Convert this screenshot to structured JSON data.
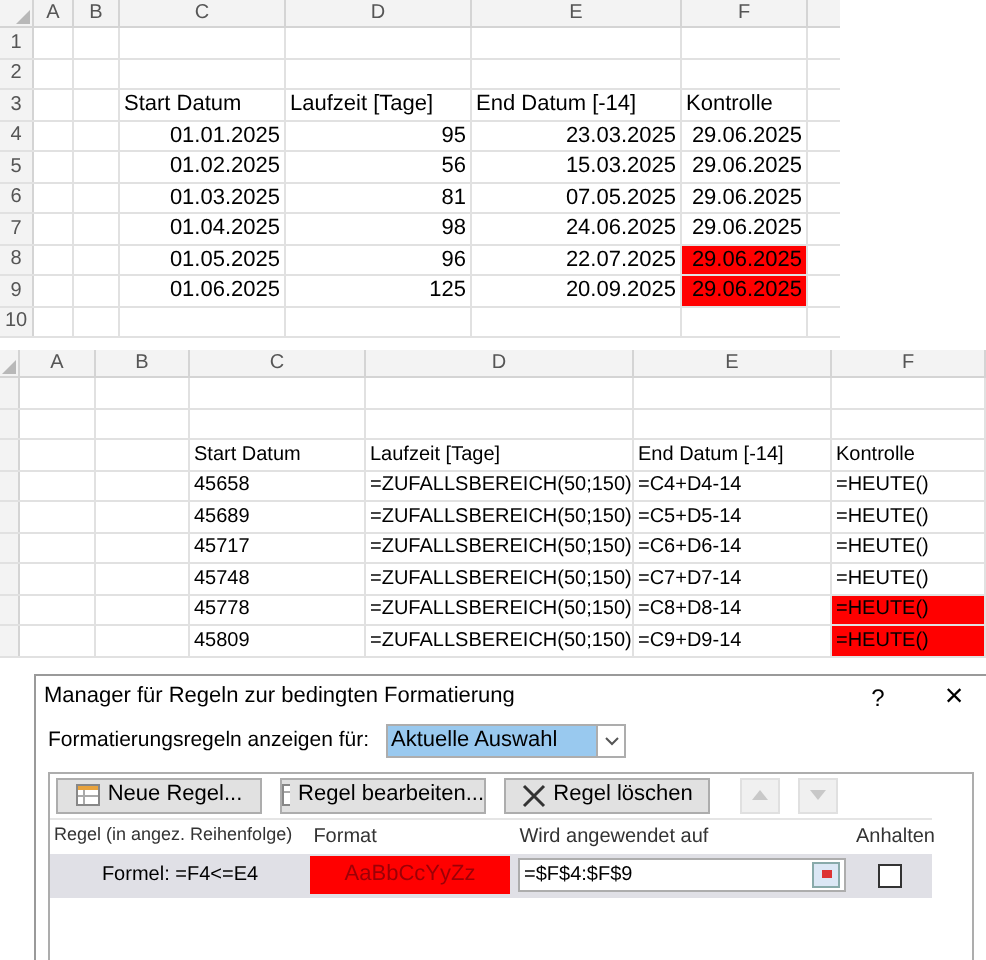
{
  "sheets": [
    {
      "columns": [
        "A",
        "B",
        "C",
        "D",
        "E",
        "F"
      ],
      "rows": [
        {
          "number": "1",
          "kind": "empty",
          "cells": []
        },
        {
          "number": "2",
          "kind": "empty",
          "cells": []
        },
        {
          "number": "3",
          "kind": "header",
          "cells": [
            {
              "text": "",
              "highlighted": false
            },
            {
              "text": "",
              "highlighted": false
            },
            {
              "text": "Start Datum",
              "highlighted": false
            },
            {
              "text": "Laufzeit [Tage]",
              "highlighted": false
            },
            {
              "text": "End Datum [-14]",
              "highlighted": false
            },
            {
              "text": "Kontrolle",
              "highlighted": false
            }
          ]
        },
        {
          "number": "4",
          "kind": "value",
          "cells": [
            {
              "text": "",
              "highlighted": false
            },
            {
              "text": "",
              "highlighted": false
            },
            {
              "text": "01.01.2025",
              "highlighted": false
            },
            {
              "text": "95",
              "highlighted": false
            },
            {
              "text": "23.03.2025",
              "highlighted": false
            },
            {
              "text": "29.06.2025",
              "highlighted": false
            }
          ]
        },
        {
          "number": "5",
          "kind": "value",
          "cells": [
            {
              "text": "",
              "highlighted": false
            },
            {
              "text": "",
              "highlighted": false
            },
            {
              "text": "01.02.2025",
              "highlighted": false
            },
            {
              "text": "56",
              "highlighted": false
            },
            {
              "text": "15.03.2025",
              "highlighted": false
            },
            {
              "text": "29.06.2025",
              "highlighted": false
            }
          ]
        },
        {
          "number": "6",
          "kind": "value",
          "cells": [
            {
              "text": "",
              "highlighted": false
            },
            {
              "text": "",
              "highlighted": false
            },
            {
              "text": "01.03.2025",
              "highlighted": false
            },
            {
              "text": "81",
              "highlighted": false
            },
            {
              "text": "07.05.2025",
              "highlighted": false
            },
            {
              "text": "29.06.2025",
              "highlighted": false
            }
          ]
        },
        {
          "number": "7",
          "kind": "value",
          "cells": [
            {
              "text": "",
              "highlighted": false
            },
            {
              "text": "",
              "highlighted": false
            },
            {
              "text": "01.04.2025",
              "highlighted": false
            },
            {
              "text": "98",
              "highlighted": false
            },
            {
              "text": "24.06.2025",
              "highlighted": false
            },
            {
              "text": "29.06.2025",
              "highlighted": false
            }
          ]
        },
        {
          "number": "8",
          "kind": "value",
          "cells": [
            {
              "text": "",
              "highlighted": false
            },
            {
              "text": "",
              "highlighted": false
            },
            {
              "text": "01.05.2025",
              "highlighted": false
            },
            {
              "text": "96",
              "highlighted": false
            },
            {
              "text": "22.07.2025",
              "highlighted": false
            },
            {
              "text": "29.06.2025",
              "highlighted": true
            }
          ]
        },
        {
          "number": "9",
          "kind": "value",
          "cells": [
            {
              "text": "",
              "highlighted": false
            },
            {
              "text": "",
              "highlighted": false
            },
            {
              "text": "01.06.2025",
              "highlighted": false
            },
            {
              "text": "125",
              "highlighted": false
            },
            {
              "text": "20.09.2025",
              "highlighted": false
            },
            {
              "text": "29.06.2025",
              "highlighted": true
            }
          ]
        },
        {
          "number": "10",
          "kind": "empty",
          "cells": []
        }
      ]
    },
    {
      "columns": [
        "A",
        "B",
        "C",
        "D",
        "E",
        "F"
      ],
      "rows": [
        {
          "kind": "empty",
          "cells": []
        },
        {
          "kind": "empty",
          "cells": []
        },
        {
          "kind": "header",
          "cells": [
            {
              "text": "",
              "highlighted": false
            },
            {
              "text": "",
              "highlighted": false
            },
            {
              "text": "Start Datum",
              "highlighted": false
            },
            {
              "text": "Laufzeit [Tage]",
              "highlighted": false
            },
            {
              "text": "End Datum [-14]",
              "highlighted": false
            },
            {
              "text": "Kontrolle",
              "highlighted": false
            }
          ]
        },
        {
          "kind": "formula",
          "cells": [
            {
              "text": "",
              "highlighted": false
            },
            {
              "text": "",
              "highlighted": false
            },
            {
              "text": "45658",
              "highlighted": false
            },
            {
              "text": "=ZUFALLSBEREICH(50;150)",
              "highlighted": false
            },
            {
              "text": "=C4+D4-14",
              "highlighted": false
            },
            {
              "text": "=HEUTE()",
              "highlighted": false
            }
          ]
        },
        {
          "kind": "formula",
          "cells": [
            {
              "text": "",
              "highlighted": false
            },
            {
              "text": "",
              "highlighted": false
            },
            {
              "text": "45689",
              "highlighted": false
            },
            {
              "text": "=ZUFALLSBEREICH(50;150)",
              "highlighted": false
            },
            {
              "text": "=C5+D5-14",
              "highlighted": false
            },
            {
              "text": "=HEUTE()",
              "highlighted": false
            }
          ]
        },
        {
          "kind": "formula",
          "cells": [
            {
              "text": "",
              "highlighted": false
            },
            {
              "text": "",
              "highlighted": false
            },
            {
              "text": "45717",
              "highlighted": false
            },
            {
              "text": "=ZUFALLSBEREICH(50;150)",
              "highlighted": false
            },
            {
              "text": "=C6+D6-14",
              "highlighted": false
            },
            {
              "text": "=HEUTE()",
              "highlighted": false
            }
          ]
        },
        {
          "kind": "formula",
          "cells": [
            {
              "text": "",
              "highlighted": false
            },
            {
              "text": "",
              "highlighted": false
            },
            {
              "text": "45748",
              "highlighted": false
            },
            {
              "text": "=ZUFALLSBEREICH(50;150)",
              "highlighted": false
            },
            {
              "text": "=C7+D7-14",
              "highlighted": false
            },
            {
              "text": "=HEUTE()",
              "highlighted": false
            }
          ]
        },
        {
          "kind": "formula",
          "cells": [
            {
              "text": "",
              "highlighted": false
            },
            {
              "text": "",
              "highlighted": false
            },
            {
              "text": "45778",
              "highlighted": false
            },
            {
              "text": "=ZUFALLSBEREICH(50;150)",
              "highlighted": false
            },
            {
              "text": "=C8+D8-14",
              "highlighted": false
            },
            {
              "text": "=HEUTE()",
              "highlighted": true
            }
          ]
        },
        {
          "kind": "formula",
          "cells": [
            {
              "text": "",
              "highlighted": false
            },
            {
              "text": "",
              "highlighted": false
            },
            {
              "text": "45809",
              "highlighted": false
            },
            {
              "text": "=ZUFALLSBEREICH(50;150)",
              "highlighted": false
            },
            {
              "text": "=C9+D9-14",
              "highlighted": false
            },
            {
              "text": "=HEUTE()",
              "highlighted": true
            }
          ]
        }
      ]
    }
  ],
  "dialog": {
    "title": "Manager für Regeln zur bedingten Formatierung",
    "help": "?",
    "close": "×",
    "show_for_label": "Formatierungsregeln anzeigen für:",
    "show_for_value": "Aktuelle Auswahl",
    "buttons": [
      {
        "label": "Neue Regel...",
        "kind": "new"
      },
      {
        "label": "Regel bearbeiten...",
        "kind": "edit"
      },
      {
        "label": "Regel löschen",
        "kind": "delete"
      }
    ],
    "move_up": {
      "disabled": true
    },
    "move_down": {
      "disabled": true
    },
    "columns": [
      "Regel (in angez. Reihenfolge)",
      "Format",
      "Wird angewendet auf",
      "Anhalten"
    ],
    "rules": [
      {
        "rule": "Formel: =F4<=E4",
        "format_preview": "AaBbCcYyZz",
        "applies_to": "=$F$4:$F$9",
        "stop": false,
        "selected": true
      }
    ]
  }
}
